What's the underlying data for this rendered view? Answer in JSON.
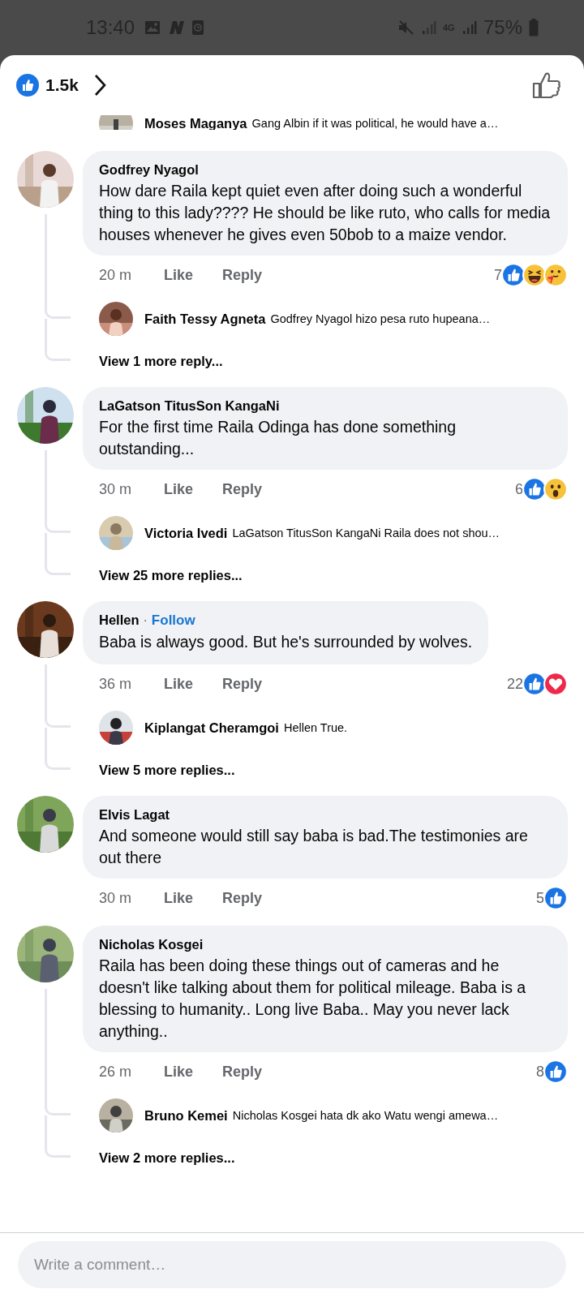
{
  "status_bar": {
    "time": "13:40",
    "network": "4G",
    "battery": "75%"
  },
  "header": {
    "reaction_count": "1.5k"
  },
  "partial_reply": {
    "name": "Moses Maganya",
    "text": "Gang Albin if it was political, he would have a…"
  },
  "comments": [
    {
      "name": "Godfrey Nyagol",
      "text": "How dare Raila kept quiet even after doing such a wonderful thing to this lady???? He should be like ruto, who calls for media houses whenever he gives even 50bob to a maize vendor.",
      "time": "20 m",
      "like": "Like",
      "reply": "Reply",
      "reaction_count": "7",
      "reactions": [
        {
          "kind": "like"
        },
        {
          "kind": "haha"
        },
        {
          "kind": "care"
        }
      ],
      "replies": [
        {
          "name": "Faith Tessy Agneta",
          "text": "Godfrey Nyagol hizo pesa ruto hupeana…"
        }
      ],
      "more": "View 1 more reply..."
    },
    {
      "name": "LaGatson TitusSon KangaNi",
      "text": "For the first time Raila Odinga has done something outstanding...",
      "time": "30 m",
      "like": "Like",
      "reply": "Reply",
      "reaction_count": "6",
      "reactions": [
        {
          "kind": "like"
        },
        {
          "kind": "wow"
        }
      ],
      "replies": [
        {
          "name": "Victoria Ivedi",
          "text": "LaGatson TitusSon KangaNi Raila does not shou…"
        }
      ],
      "more": "View 25 more replies..."
    },
    {
      "name": "Hellen",
      "separator": "·",
      "follow": "Follow",
      "text": "Baba is always good. But he's surrounded by wolves.",
      "time": "36 m",
      "like": "Like",
      "reply": "Reply",
      "reaction_count": "22",
      "reactions": [
        {
          "kind": "like"
        },
        {
          "kind": "love"
        }
      ],
      "replies": [
        {
          "name": "Kiplangat Cheramgoi",
          "text": "Hellen True."
        }
      ],
      "more": "View 5 more replies..."
    },
    {
      "name": "Elvis Lagat",
      "text": "And someone would still say baba is bad.The testimonies are out there",
      "time": "30 m",
      "like": "Like",
      "reply": "Reply",
      "reaction_count": "5",
      "reactions": [
        {
          "kind": "like"
        }
      ]
    },
    {
      "name": "Nicholas Kosgei",
      "text": "Raila has been doing these things out of cameras and he doesn't like talking about them for political mileage. Baba is a blessing to humanity.. Long live Baba.. May you never lack anything..",
      "time": "26 m",
      "like": "Like",
      "reply": "Reply",
      "reaction_count": "8",
      "reactions": [
        {
          "kind": "like"
        }
      ],
      "replies": [
        {
          "name": "Bruno Kemei",
          "text": "Nicholas Kosgei hata dk ako Watu wengi amewa…"
        }
      ],
      "more": "View 2 more replies..."
    }
  ],
  "composer": {
    "placeholder": "Write a comment…"
  }
}
